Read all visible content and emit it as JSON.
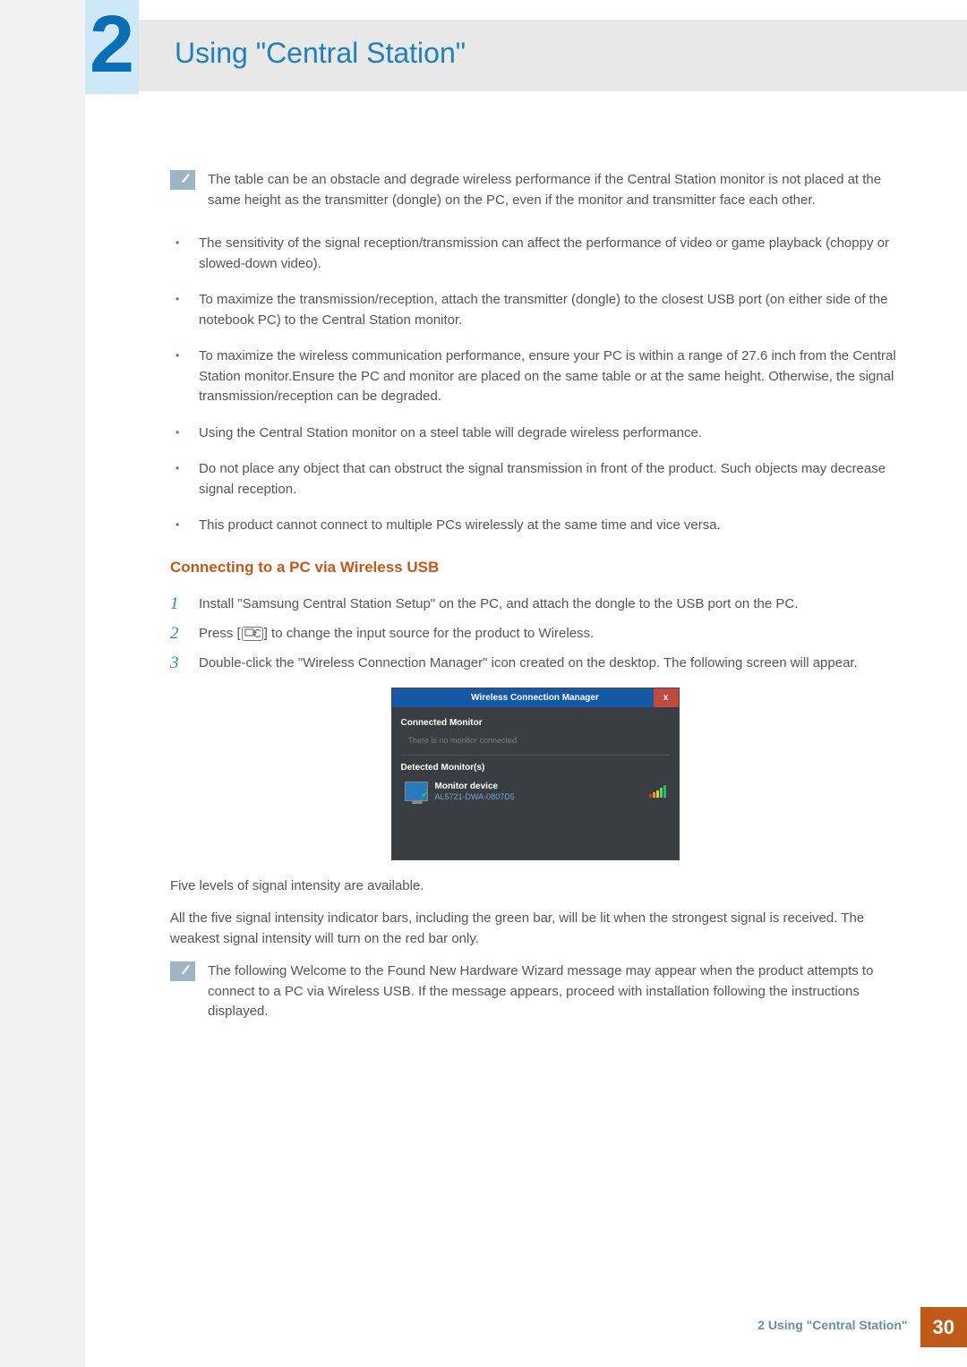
{
  "chapter": {
    "number": "2",
    "title": "Using \"Central Station\""
  },
  "note_top": "The table can be an obstacle and degrade wireless performance if the Central Station monitor is not placed at the same height as the transmitter (dongle) on the PC, even if the monitor and transmitter face each other.",
  "bullets": [
    "The sensitivity of the signal reception/transmission can affect the performance of video or game playback (choppy or slowed-down video).",
    "To maximize the transmission/reception, attach the transmitter (dongle) to the closest USB port (on either side of the notebook PC) to the Central Station monitor.",
    "To maximize the wireless communication performance, ensure your PC is within a range of 27.6 inch from the Central Station monitor.Ensure the PC and monitor are placed on the same table or at the same height. Otherwise, the signal transmission/reception can be degraded.",
    "Using the Central Station monitor on a steel table will degrade wireless performance.",
    "Do not place any object that can obstruct the signal transmission in front of the product. Such objects may decrease signal reception.",
    "This product cannot connect to multiple PCs wirelessly at the same time and vice versa."
  ],
  "subhead": "Connecting to a PC via Wireless USB",
  "steps": {
    "s1": "Install \"Samsung Central Station Setup\" on the PC, and attach the dongle to the USB port on the PC.",
    "s2_pre": "Press [",
    "s2_post": "] to change the input source for the product to Wireless.",
    "s3": "Double-click the \"Wireless Connection Manager\" icon created on the desktop. The following screen will appear."
  },
  "wcm": {
    "title": "Wireless Connection Manager",
    "close": "x",
    "connected_label": "Connected Monitor",
    "connected_msg": "There is no monitor connected",
    "detected_label": "Detected Monitor(s)",
    "device_name": "Monitor device",
    "device_id": "AL5721-DWA-0807D5"
  },
  "after_wcm": {
    "p1": "Five levels of signal intensity are available.",
    "p2": "All the five signal intensity indicator bars, including the green bar, will be lit when the strongest signal is received. The weakest signal intensity will turn on the red bar only."
  },
  "note_bottom": "The following Welcome to the Found New Hardware Wizard message may appear when the product attempts to connect to a PC via Wireless USB. If the message appears, proceed with installation following the instructions displayed.",
  "footer": {
    "text": "2 Using \"Central Station\"",
    "page": "30"
  }
}
